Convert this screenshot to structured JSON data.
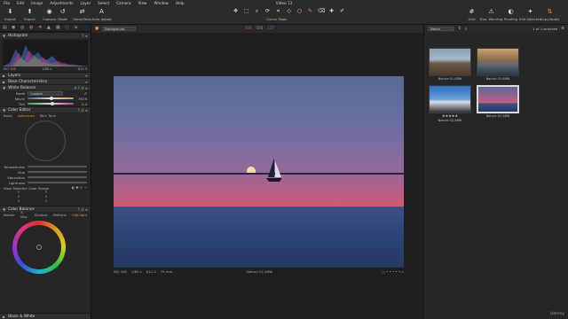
{
  "menu": [
    "File",
    "Edit",
    "Image",
    "Adjustments",
    "Layer",
    "Select",
    "Camera",
    "View",
    "Window",
    "Help"
  ],
  "window_title": "Video 13",
  "toolbar": {
    "left_buttons": [
      "Import",
      "Export",
      "Capture"
    ],
    "mid_buttons": [
      "Reset",
      "Undo/Redo",
      "Auto Adjust"
    ],
    "cursor_tools_label": "Cursor Tools",
    "right_buttons": [
      "Grid",
      "Exp. Warning",
      "Proofing",
      "Edit Selected",
      "Copy/Apply"
    ]
  },
  "left": {
    "histogram": {
      "title": "Histogram",
      "iso": "ISO 100",
      "shutter": "1/80 s",
      "aperture": "f/11.3"
    },
    "layers_title": "Layers",
    "base_title": "Base Characteristics",
    "white_balance": {
      "title": "White Balance",
      "mode_label": "Mode",
      "mode_value": "Custom",
      "kelvin_label": "Kelvin",
      "kelvin_value": "5519",
      "tint_label": "Tint",
      "tint_value": "0.4"
    },
    "color_editor": {
      "title": "Color Editor",
      "tabs": [
        "Basic",
        "Advanced",
        "Skin Tone"
      ],
      "active_tab": "Advanced",
      "smoothness_label": "Smoothness",
      "hue_label": "Hue",
      "saturation_label": "Saturation",
      "lightness_label": "Lightness",
      "view_range_label": "View Selected Color Range",
      "grid_values": [
        "0",
        "0",
        "0",
        "0",
        "0",
        "0"
      ]
    },
    "color_balance": {
      "title": "Color Balance",
      "tabs": [
        "Master",
        "3-Way",
        "Shadow",
        "Midtone",
        "Highlight"
      ],
      "active_tab": "Highlight"
    },
    "bw_title": "Black & White"
  },
  "viewer": {
    "variant_label": "Background",
    "clip_values": [
      "104",
      "105",
      "127"
    ],
    "file_name": "Nature 07.ARW",
    "iso": "ISO 100",
    "shutter": "1/80 s",
    "aperture": "f/11.3",
    "focal": "75 mm"
  },
  "browser": {
    "sort_label": "Name",
    "count_text": "1 of 4 selected",
    "thumbnails": [
      {
        "caption": "Nature 01.ARW",
        "selected": false
      },
      {
        "caption": "Nature 03.ARW",
        "selected": false
      },
      {
        "caption": "Nature 04.ARW",
        "selected": false
      },
      {
        "caption": "Nature 07.ARW",
        "selected": true
      }
    ]
  },
  "colors": {
    "accent": "#f08a2a",
    "panel": "#262626",
    "viewer_bg": "#1f1f1f"
  },
  "watermark": "Udemy"
}
